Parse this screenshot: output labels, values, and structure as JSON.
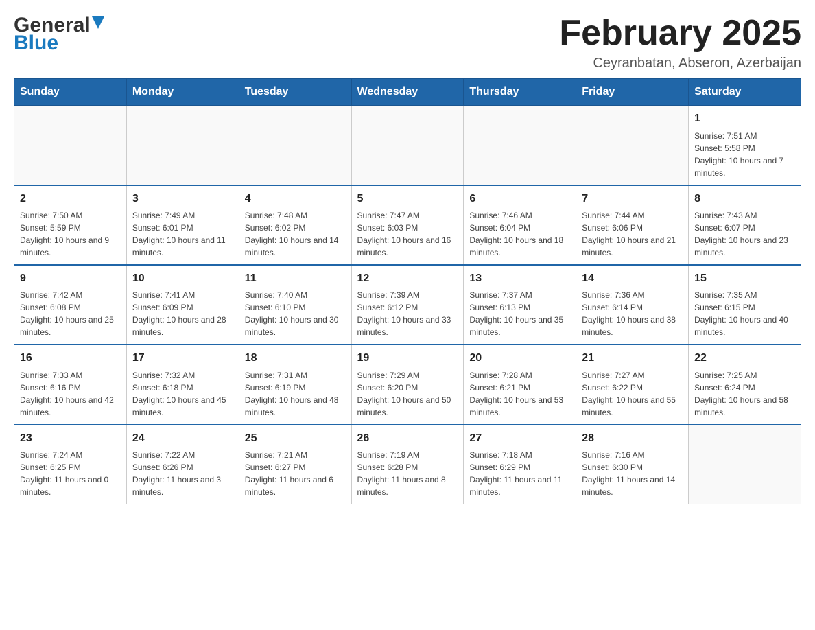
{
  "header": {
    "logo_general": "General",
    "logo_blue": "Blue",
    "title": "February 2025",
    "subtitle": "Ceyranbatan, Abseron, Azerbaijan"
  },
  "days_of_week": [
    "Sunday",
    "Monday",
    "Tuesday",
    "Wednesday",
    "Thursday",
    "Friday",
    "Saturday"
  ],
  "weeks": [
    [
      {
        "day": "",
        "info": ""
      },
      {
        "day": "",
        "info": ""
      },
      {
        "day": "",
        "info": ""
      },
      {
        "day": "",
        "info": ""
      },
      {
        "day": "",
        "info": ""
      },
      {
        "day": "",
        "info": ""
      },
      {
        "day": "1",
        "info": "Sunrise: 7:51 AM\nSunset: 5:58 PM\nDaylight: 10 hours and 7 minutes."
      }
    ],
    [
      {
        "day": "2",
        "info": "Sunrise: 7:50 AM\nSunset: 5:59 PM\nDaylight: 10 hours and 9 minutes."
      },
      {
        "day": "3",
        "info": "Sunrise: 7:49 AM\nSunset: 6:01 PM\nDaylight: 10 hours and 11 minutes."
      },
      {
        "day": "4",
        "info": "Sunrise: 7:48 AM\nSunset: 6:02 PM\nDaylight: 10 hours and 14 minutes."
      },
      {
        "day": "5",
        "info": "Sunrise: 7:47 AM\nSunset: 6:03 PM\nDaylight: 10 hours and 16 minutes."
      },
      {
        "day": "6",
        "info": "Sunrise: 7:46 AM\nSunset: 6:04 PM\nDaylight: 10 hours and 18 minutes."
      },
      {
        "day": "7",
        "info": "Sunrise: 7:44 AM\nSunset: 6:06 PM\nDaylight: 10 hours and 21 minutes."
      },
      {
        "day": "8",
        "info": "Sunrise: 7:43 AM\nSunset: 6:07 PM\nDaylight: 10 hours and 23 minutes."
      }
    ],
    [
      {
        "day": "9",
        "info": "Sunrise: 7:42 AM\nSunset: 6:08 PM\nDaylight: 10 hours and 25 minutes."
      },
      {
        "day": "10",
        "info": "Sunrise: 7:41 AM\nSunset: 6:09 PM\nDaylight: 10 hours and 28 minutes."
      },
      {
        "day": "11",
        "info": "Sunrise: 7:40 AM\nSunset: 6:10 PM\nDaylight: 10 hours and 30 minutes."
      },
      {
        "day": "12",
        "info": "Sunrise: 7:39 AM\nSunset: 6:12 PM\nDaylight: 10 hours and 33 minutes."
      },
      {
        "day": "13",
        "info": "Sunrise: 7:37 AM\nSunset: 6:13 PM\nDaylight: 10 hours and 35 minutes."
      },
      {
        "day": "14",
        "info": "Sunrise: 7:36 AM\nSunset: 6:14 PM\nDaylight: 10 hours and 38 minutes."
      },
      {
        "day": "15",
        "info": "Sunrise: 7:35 AM\nSunset: 6:15 PM\nDaylight: 10 hours and 40 minutes."
      }
    ],
    [
      {
        "day": "16",
        "info": "Sunrise: 7:33 AM\nSunset: 6:16 PM\nDaylight: 10 hours and 42 minutes."
      },
      {
        "day": "17",
        "info": "Sunrise: 7:32 AM\nSunset: 6:18 PM\nDaylight: 10 hours and 45 minutes."
      },
      {
        "day": "18",
        "info": "Sunrise: 7:31 AM\nSunset: 6:19 PM\nDaylight: 10 hours and 48 minutes."
      },
      {
        "day": "19",
        "info": "Sunrise: 7:29 AM\nSunset: 6:20 PM\nDaylight: 10 hours and 50 minutes."
      },
      {
        "day": "20",
        "info": "Sunrise: 7:28 AM\nSunset: 6:21 PM\nDaylight: 10 hours and 53 minutes."
      },
      {
        "day": "21",
        "info": "Sunrise: 7:27 AM\nSunset: 6:22 PM\nDaylight: 10 hours and 55 minutes."
      },
      {
        "day": "22",
        "info": "Sunrise: 7:25 AM\nSunset: 6:24 PM\nDaylight: 10 hours and 58 minutes."
      }
    ],
    [
      {
        "day": "23",
        "info": "Sunrise: 7:24 AM\nSunset: 6:25 PM\nDaylight: 11 hours and 0 minutes."
      },
      {
        "day": "24",
        "info": "Sunrise: 7:22 AM\nSunset: 6:26 PM\nDaylight: 11 hours and 3 minutes."
      },
      {
        "day": "25",
        "info": "Sunrise: 7:21 AM\nSunset: 6:27 PM\nDaylight: 11 hours and 6 minutes."
      },
      {
        "day": "26",
        "info": "Sunrise: 7:19 AM\nSunset: 6:28 PM\nDaylight: 11 hours and 8 minutes."
      },
      {
        "day": "27",
        "info": "Sunrise: 7:18 AM\nSunset: 6:29 PM\nDaylight: 11 hours and 11 minutes."
      },
      {
        "day": "28",
        "info": "Sunrise: 7:16 AM\nSunset: 6:30 PM\nDaylight: 11 hours and 14 minutes."
      },
      {
        "day": "",
        "info": ""
      }
    ]
  ]
}
